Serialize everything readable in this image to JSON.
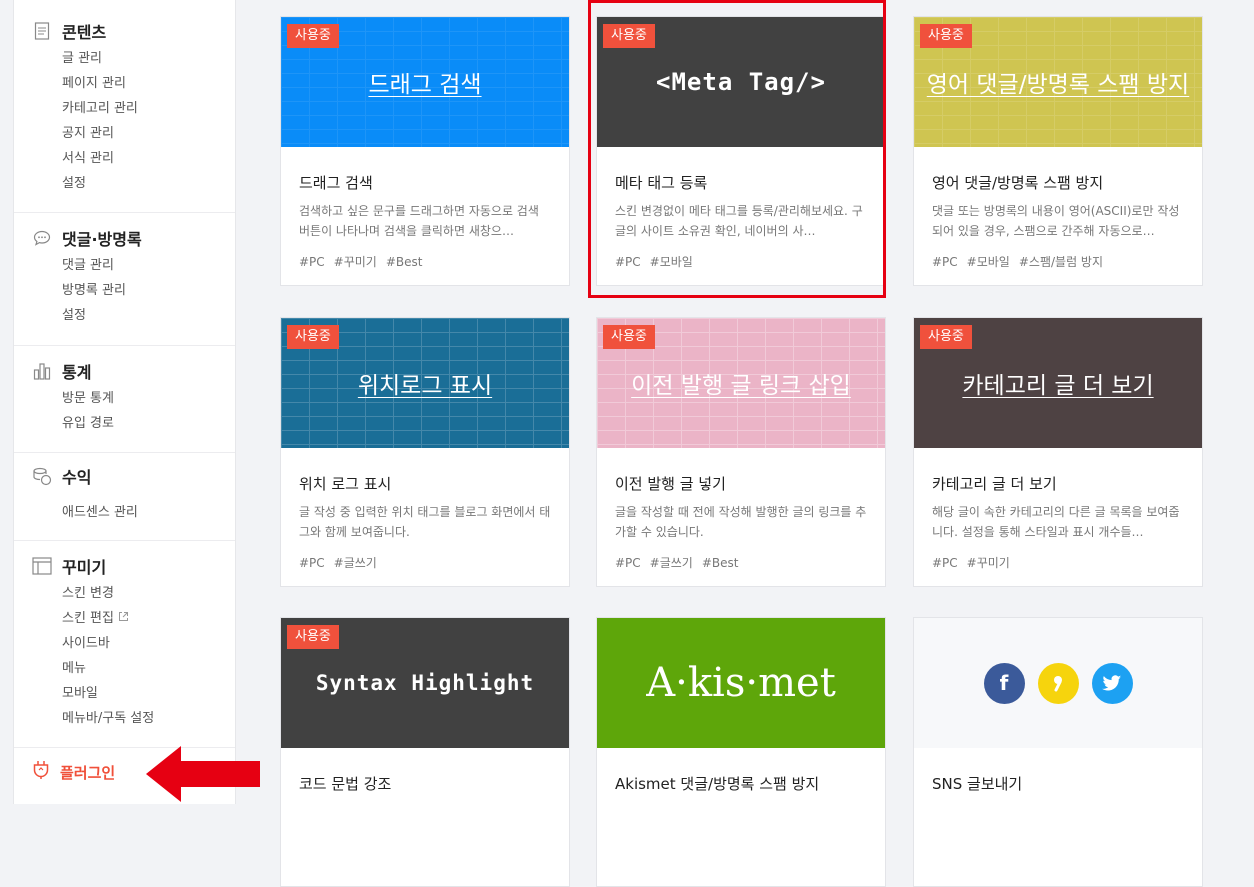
{
  "sidebar": {
    "sections": [
      {
        "title": "콘텐츠",
        "icon": "document-icon",
        "items": [
          "글 관리",
          "페이지 관리",
          "카테고리 관리",
          "공지 관리",
          "서식 관리",
          "설정"
        ]
      },
      {
        "title": "댓글·방명록",
        "icon": "speech-bubble-icon",
        "items": [
          "댓글 관리",
          "방명록 관리",
          "설정"
        ]
      },
      {
        "title": "통계",
        "icon": "bar-chart-icon",
        "items": [
          "방문 통계",
          "유입 경로"
        ]
      },
      {
        "title": "수익",
        "icon": "coins-icon",
        "items": [
          "애드센스 관리"
        ]
      },
      {
        "title": "꾸미기",
        "icon": "layout-icon",
        "items": [
          "스킨 변경",
          "스킨 편집",
          "사이드바",
          "메뉴",
          "모바일",
          "메뉴바/구독 설정"
        ]
      }
    ],
    "plugin": {
      "title": "플러그인",
      "icon": "plug-icon"
    }
  },
  "badge_label": "사용중",
  "cards": [
    {
      "banner": "드래그 검색",
      "banner_color": "#0a8cf8",
      "title": "드래그 검색",
      "desc": "검색하고 싶은 문구를 드래그하면 자동으로 검색 버튼이 나타나며 검색을 클릭하면 새창으…",
      "tags": [
        "#PC",
        "#꾸미기",
        "#Best"
      ],
      "in_use": true
    },
    {
      "banner": "<Meta Tag/>",
      "banner_color": "#414141",
      "title": "메타 태그 등록",
      "desc": "스킨 변경없이 메타 태그를 등록/관리해보세요. 구글의 사이트 소유권 확인, 네이버의 사…",
      "tags": [
        "#PC",
        "#모바일"
      ],
      "in_use": true
    },
    {
      "banner": "영어 댓글/방명록 스팸 방지",
      "banner_color": "#cfc551",
      "title": "영어 댓글/방명록 스팸 방지",
      "desc": "댓글 또는 방명록의 내용이 영어(ASCII)로만 작성되어 있을 경우, 스팸으로 간주해 자동으로…",
      "tags": [
        "#PC",
        "#모바일",
        "#스팸/블럼 방지"
      ],
      "in_use": true
    },
    {
      "banner": "위치로그 표시",
      "banner_color": "#1a6e97",
      "title": "위치 로그 표시",
      "desc": "글 작성 중 입력한 위치 태그를 블로그 화면에서 태그와 함께 보여줍니다.",
      "tags": [
        "#PC",
        "#글쓰기"
      ],
      "in_use": true
    },
    {
      "banner": "이전 발행 글 링크 삽입",
      "banner_color": "#ebb4c7",
      "title": "이전 발행 글 넣기",
      "desc": "글을 작성할 때 전에 작성해 발행한 글의 링크를 추가할 수 있습니다.",
      "tags": [
        "#PC",
        "#글쓰기",
        "#Best"
      ],
      "in_use": true
    },
    {
      "banner": "카테고리 글 더 보기",
      "banner_color": "#4e4243",
      "title": "카테고리 글 더 보기",
      "desc": "해당 글이 속한 카테고리의 다른 글 목록을 보여줍니다. 설정을 통해 스타일과 표시 개수들…",
      "tags": [
        "#PC",
        "#꾸미기"
      ],
      "in_use": true
    },
    {
      "banner": "Syntax Highlight",
      "banner_color": "#414141",
      "title": "코드 문법 강조",
      "desc": "",
      "tags": [],
      "in_use": true
    },
    {
      "banner": "A·kis·met",
      "banner_color": "#5ea60a",
      "title": "Akismet 댓글/방명록 스팸 방지",
      "desc": "",
      "tags": [],
      "in_use": false
    },
    {
      "banner": "",
      "banner_color": "#f7f8fa",
      "title": "SNS 글보내기",
      "desc": "",
      "tags": [],
      "in_use": false,
      "sns_icons": [
        "facebook-icon",
        "kakao-story-icon",
        "twitter-icon"
      ]
    }
  ],
  "colors": {
    "accent": "#f0513c",
    "highlight": "#e60012"
  }
}
